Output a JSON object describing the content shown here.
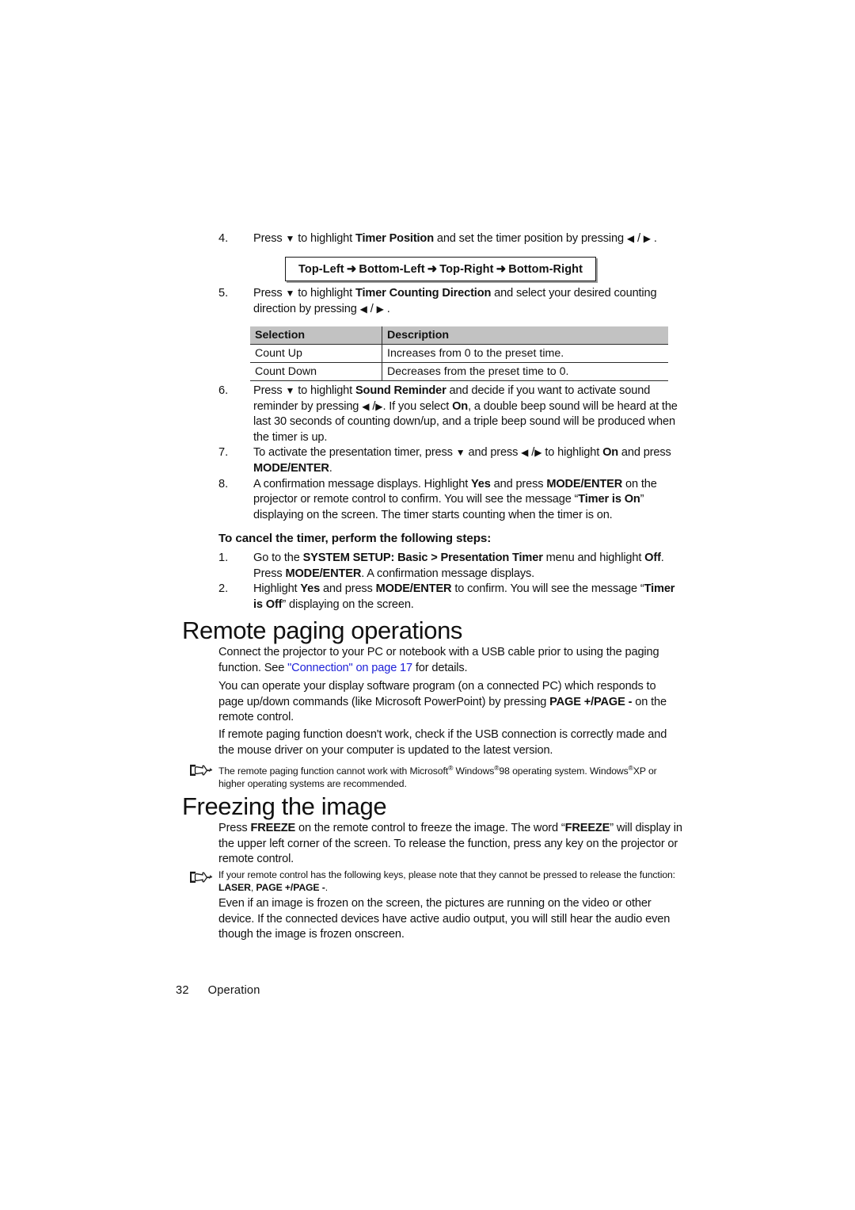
{
  "page": {
    "number": "32",
    "section_label": "Operation"
  },
  "steps_top": [
    {
      "num": "4.",
      "segments": [
        {
          "t": "Press ",
          "s": "n"
        },
        {
          "t": "▼",
          "s": "tri"
        },
        {
          "t": " to highlight ",
          "s": "n"
        },
        {
          "t": "Timer Position",
          "s": "b"
        },
        {
          "t": " and set the timer position by pressing ",
          "s": "n"
        },
        {
          "t": "◀",
          "s": "tri"
        },
        {
          "t": " / ",
          "s": "n"
        },
        {
          "t": "▶",
          "s": "tri"
        },
        {
          "t": " .",
          "s": "n"
        }
      ]
    }
  ],
  "arrow_box": {
    "items": [
      "Top-Left",
      "Bottom-Left",
      "Top-Right",
      "Bottom-Right"
    ],
    "arrow": "➜"
  },
  "steps_mid": [
    {
      "num": "5.",
      "segments": [
        {
          "t": "Press ",
          "s": "n"
        },
        {
          "t": "▼",
          "s": "tri"
        },
        {
          "t": " to highlight ",
          "s": "n"
        },
        {
          "t": "Timer Counting Direction",
          "s": "b"
        },
        {
          "t": " and select your desired counting direction by pressing ",
          "s": "n"
        },
        {
          "t": "◀",
          "s": "tri"
        },
        {
          "t": " / ",
          "s": "n"
        },
        {
          "t": "▶",
          "s": "tri"
        },
        {
          "t": " .",
          "s": "n"
        }
      ]
    }
  ],
  "selection_table": {
    "headers": [
      "Selection",
      "Description"
    ],
    "rows": [
      [
        "Count Up",
        "Increases from 0 to the preset time."
      ],
      [
        "Count Down",
        "Decreases from the preset time to 0."
      ]
    ]
  },
  "steps_bottom": [
    {
      "num": "6.",
      "segments": [
        {
          "t": "Press ",
          "s": "n"
        },
        {
          "t": "▼",
          "s": "tri"
        },
        {
          "t": " to highlight ",
          "s": "n"
        },
        {
          "t": "Sound Reminder",
          "s": "b"
        },
        {
          "t": " and decide if you want to activate sound reminder by pressing ",
          "s": "n"
        },
        {
          "t": "◀",
          "s": "tri"
        },
        {
          "t": " /",
          "s": "n"
        },
        {
          "t": "▶",
          "s": "tri"
        },
        {
          "t": ". If you select ",
          "s": "n"
        },
        {
          "t": "On",
          "s": "b"
        },
        {
          "t": ", a double beep sound will be heard at the last 30 seconds of counting down/up, and a triple beep sound will be produced when the timer is up.",
          "s": "n"
        }
      ]
    },
    {
      "num": "7.",
      "segments": [
        {
          "t": "To activate the presentation timer, press ",
          "s": "n"
        },
        {
          "t": "▼",
          "s": "tri"
        },
        {
          "t": " and press ",
          "s": "n"
        },
        {
          "t": "◀",
          "s": "tri"
        },
        {
          "t": " /",
          "s": "n"
        },
        {
          "t": "▶",
          "s": "tri"
        },
        {
          "t": " to highlight ",
          "s": "n"
        },
        {
          "t": "On",
          "s": "b"
        },
        {
          "t": " and press ",
          "s": "n"
        },
        {
          "t": "MODE/ENTER",
          "s": "b"
        },
        {
          "t": ".",
          "s": "n"
        }
      ]
    },
    {
      "num": "8.",
      "segments": [
        {
          "t": "A confirmation message displays. Highlight ",
          "s": "n"
        },
        {
          "t": "Yes",
          "s": "b"
        },
        {
          "t": " and press ",
          "s": "n"
        },
        {
          "t": "MODE/ENTER",
          "s": "b"
        },
        {
          "t": " on the projector or remote control to confirm. You will see the message “",
          "s": "n"
        },
        {
          "t": "Timer is On",
          "s": "b"
        },
        {
          "t": "” displaying on the screen. The timer starts counting when the timer is on.",
          "s": "n"
        }
      ]
    }
  ],
  "cancel_heading": "To cancel the timer, perform the following steps:",
  "cancel_steps": [
    {
      "num": "1.",
      "segments": [
        {
          "t": "Go to the ",
          "s": "n"
        },
        {
          "t": "SYSTEM SETUP: Basic > Presentation Timer",
          "s": "b"
        },
        {
          "t": " menu and highlight ",
          "s": "n"
        },
        {
          "t": "Off",
          "s": "b"
        },
        {
          "t": ". Press ",
          "s": "n"
        },
        {
          "t": "MODE/ENTER",
          "s": "b"
        },
        {
          "t": ". A confirmation message displays.",
          "s": "n"
        }
      ]
    },
    {
      "num": "2.",
      "segments": [
        {
          "t": "Highlight ",
          "s": "n"
        },
        {
          "t": "Yes",
          "s": "b"
        },
        {
          "t": " and press ",
          "s": "n"
        },
        {
          "t": "MODE/ENTER",
          "s": "b"
        },
        {
          "t": " to confirm. You will see the message “",
          "s": "n"
        },
        {
          "t": "Timer is Off",
          "s": "b"
        },
        {
          "t": "” displaying on the screen.",
          "s": "n"
        }
      ]
    }
  ],
  "remote_paging": {
    "heading": "Remote paging operations",
    "para1": [
      {
        "t": "Connect the projector to your PC or notebook with a USB cable prior to using the paging function. See ",
        "s": "n"
      },
      {
        "t": "\"Connection\" on page 17",
        "s": "link"
      },
      {
        "t": " for details.",
        "s": "n"
      }
    ],
    "para2": [
      {
        "t": "You can operate your display software program (on a connected PC) which responds to page up/down commands (like Microsoft PowerPoint) by pressing ",
        "s": "n"
      },
      {
        "t": "PAGE +/PAGE -",
        "s": "b"
      },
      {
        "t": " on the remote control.",
        "s": "n"
      }
    ],
    "para3": [
      {
        "t": "If remote paging function doesn't work, check if the USB connection is correctly made and the mouse driver on your computer is updated to the latest version.",
        "s": "n"
      }
    ],
    "note": [
      {
        "t": "The remote paging function cannot work with Microsoft",
        "s": "n"
      },
      {
        "t": "®",
        "s": "sup"
      },
      {
        "t": " Windows",
        "s": "n"
      },
      {
        "t": "®",
        "s": "sup"
      },
      {
        "t": "98 operating system. Windows",
        "s": "n"
      },
      {
        "t": "®",
        "s": "sup"
      },
      {
        "t": "XP or higher operating systems are recommended.",
        "s": "n"
      }
    ]
  },
  "freezing": {
    "heading": "Freezing the image",
    "para1": [
      {
        "t": "Press ",
        "s": "n"
      },
      {
        "t": "FREEZE",
        "s": "b"
      },
      {
        "t": " on the remote control to freeze the image. The word “",
        "s": "n"
      },
      {
        "t": "FREEZE",
        "s": "b"
      },
      {
        "t": "” will display in the upper left corner of the screen. To release the function, press any key on the projector or remote control.",
        "s": "n"
      }
    ],
    "note": [
      {
        "t": "If your remote control has the following keys, please note that they cannot be pressed to release the function: ",
        "s": "n"
      },
      {
        "t": "LASER",
        "s": "b"
      },
      {
        "t": ", ",
        "s": "n"
      },
      {
        "t": "PAGE +/PAGE -",
        "s": "b"
      },
      {
        "t": ".",
        "s": "n"
      }
    ],
    "para2": [
      {
        "t": "Even if an image is frozen on the screen, the pictures are running on the video or other device. If the connected devices have active audio output, you will still hear the audio even though the image is frozen onscreen.",
        "s": "n"
      }
    ]
  },
  "colors": {
    "link": "#1f21d8",
    "table_header_bg": "#c2c2c2",
    "text": "#111111"
  }
}
